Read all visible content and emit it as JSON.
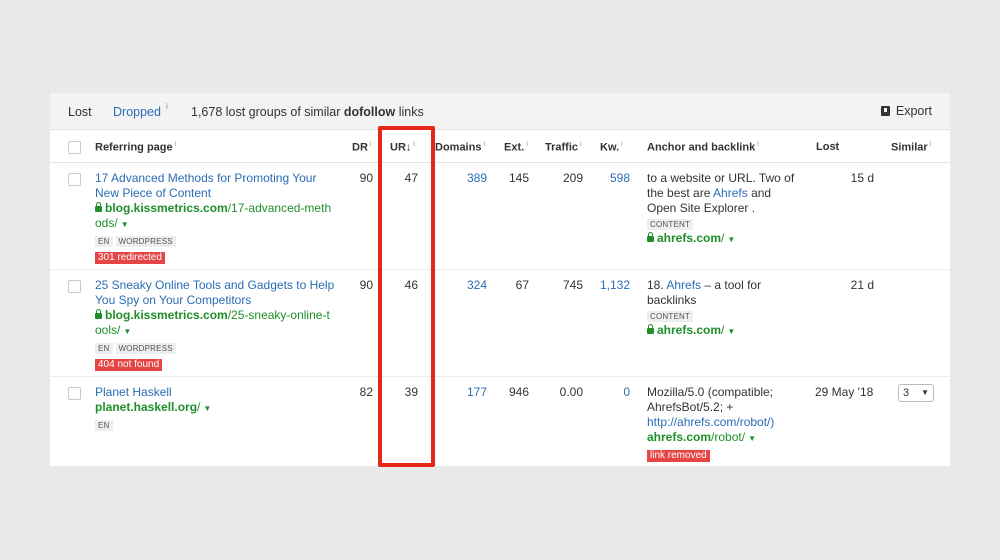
{
  "topbar": {
    "lost_label": "Lost",
    "dropped_label": "Dropped",
    "dropped_info": "i",
    "summary_prefix": "1,678 lost groups of similar ",
    "summary_bold": "dofollow",
    "summary_suffix": " links",
    "export_label": "Export"
  },
  "columns": {
    "referring_page": "Referring page",
    "dr": "DR",
    "ur": "UR",
    "ur_sort_icon": "↓",
    "domains": "Domains",
    "ext": "Ext.",
    "traffic": "Traffic",
    "kw": "Kw.",
    "anchor": "Anchor and backlink",
    "lost": "Lost",
    "similar": "Similar",
    "info": "i"
  },
  "rows": [
    {
      "title_line1": "17 Advanced Methods for Promoting Your",
      "title_line2": "New Piece of Content",
      "url_domain": "blog.kissmetrics.com",
      "url_path1": "/17-advanced-meth",
      "url_path2": "ods/",
      "tags": [
        "EN",
        "WORDPRESS"
      ],
      "badge": "301 redirected",
      "dr": "90",
      "ur": "47",
      "domains": "389",
      "ext": "145",
      "traffic": "209",
      "kw": "598",
      "anchor_line1": "to a website or URL. Two of",
      "anchor_line2_a": "the best are ",
      "anchor_line2_link": "Ahrefs",
      "anchor_line2_b": " and",
      "anchor_line3": "Open Site Explorer .",
      "anchor_tag": "CONTENT",
      "backlink_domain": "ahrefs.com",
      "backlink_path": "/",
      "lost": "15 d"
    },
    {
      "title_line1": "25 Sneaky Online Tools and Gadgets to Help",
      "title_line2": "You Spy on Your Competitors",
      "url_domain": "blog.kissmetrics.com",
      "url_path1": "/25-sneaky-online-t",
      "url_path2": "ools/",
      "tags": [
        "EN",
        "WORDPRESS"
      ],
      "badge": "404 not found",
      "dr": "90",
      "ur": "46",
      "domains": "324",
      "ext": "67",
      "traffic": "745",
      "kw": "1,132",
      "anchor_line1_a": "18. ",
      "anchor_line1_link": "Ahrefs",
      "anchor_line1_b": " – a tool for",
      "anchor_line2": "backlinks",
      "anchor_tag": "CONTENT",
      "backlink_domain": "ahrefs.com",
      "backlink_path": "/",
      "lost": "21 d"
    },
    {
      "title_line1": "Planet Haskell",
      "url_domain": "planet.haskell.org",
      "url_path1": "/",
      "tags": [
        "EN"
      ],
      "dr": "82",
      "ur": "39",
      "domains": "177",
      "ext": "946",
      "traffic": "0.00",
      "kw": "0",
      "anchor_line1": "Mozilla/5.0 (compatible;",
      "anchor_line2": "AhrefsBot/5.2; +",
      "anchor_line3": "http://ahrefs.com/robot/)",
      "backlink_domain": "ahrefs.com",
      "backlink_path": "/robot/",
      "badge": "link removed",
      "lost": "29 May '18",
      "similar": "3"
    }
  ],
  "colors": {
    "link": "#2a6db5",
    "url_green": "#1f8f2a",
    "badge_red": "#e64545",
    "highlight": "#e62617"
  }
}
